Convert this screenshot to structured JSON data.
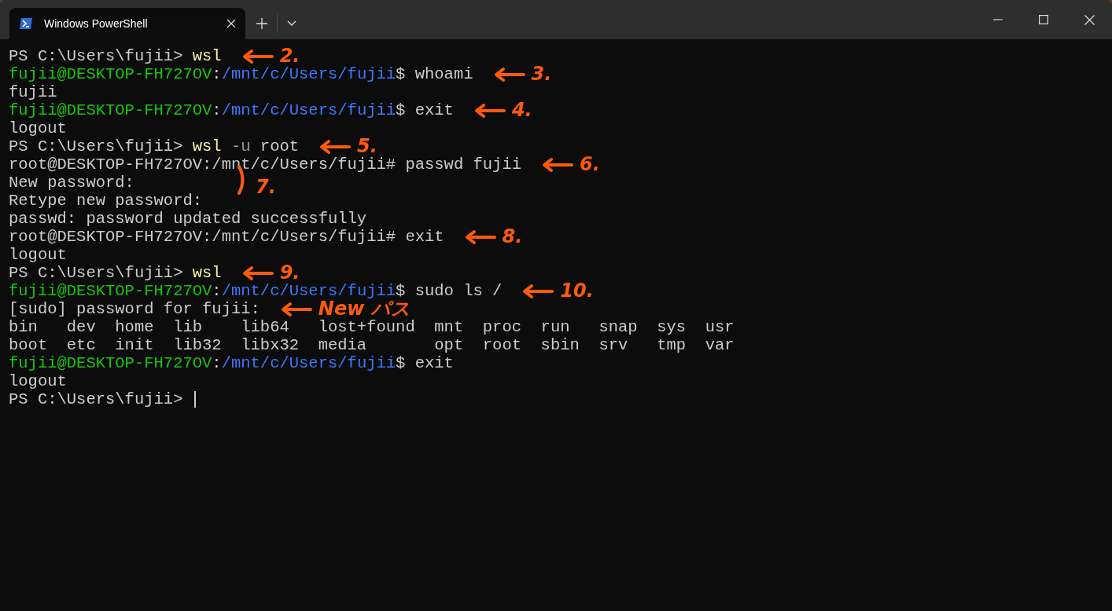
{
  "window": {
    "tabs": [
      {
        "title": "Windows PowerShell",
        "selected": true
      }
    ]
  },
  "terminal": {
    "lines": [
      {
        "segments": [
          {
            "kind": "plain",
            "text": "PS C:\\Users\\fujii> "
          },
          {
            "kind": "command",
            "text": "wsl"
          }
        ],
        "note": {
          "kind": "arrow",
          "text": "2."
        }
      },
      {
        "segments": [
          {
            "kind": "user",
            "text": "fujii@DESKTOP-FH727OV"
          },
          {
            "kind": "plain",
            "text": ":"
          },
          {
            "kind": "path",
            "text": "/mnt/c/Users/fujii"
          },
          {
            "kind": "plain",
            "text": "$ whoami"
          }
        ],
        "note": {
          "kind": "arrow",
          "text": "3."
        }
      },
      {
        "segments": [
          {
            "kind": "plain",
            "text": "fujii"
          }
        ]
      },
      {
        "segments": [
          {
            "kind": "user",
            "text": "fujii@DESKTOP-FH727OV"
          },
          {
            "kind": "plain",
            "text": ":"
          },
          {
            "kind": "path",
            "text": "/mnt/c/Users/fujii"
          },
          {
            "kind": "plain",
            "text": "$ exit"
          }
        ],
        "note": {
          "kind": "arrow",
          "text": "4."
        }
      },
      {
        "segments": [
          {
            "kind": "plain",
            "text": "logout"
          }
        ]
      },
      {
        "segments": [
          {
            "kind": "plain",
            "text": "PS C:\\Users\\fujii> "
          },
          {
            "kind": "command",
            "text": "wsl"
          },
          {
            "kind": "flag",
            "text": " -u"
          },
          {
            "kind": "plain",
            "text": " root"
          }
        ],
        "note": {
          "kind": "arrow",
          "text": "5."
        }
      },
      {
        "segments": [
          {
            "kind": "plain",
            "text": "root@DESKTOP-FH727OV:/mnt/c/Users/fujii# passwd fujii"
          }
        ],
        "note": {
          "kind": "arrow",
          "text": "6."
        }
      },
      {
        "segments": [
          {
            "kind": "plain",
            "text": "New password:"
          }
        ],
        "note": {
          "kind": "bracket",
          "text": "7."
        }
      },
      {
        "segments": [
          {
            "kind": "plain",
            "text": "Retype new password:"
          }
        ]
      },
      {
        "segments": [
          {
            "kind": "plain",
            "text": "passwd: password updated successfully"
          }
        ]
      },
      {
        "segments": [
          {
            "kind": "plain",
            "text": "root@DESKTOP-FH727OV:/mnt/c/Users/fujii# exit"
          }
        ],
        "note": {
          "kind": "arrow",
          "text": "8."
        }
      },
      {
        "segments": [
          {
            "kind": "plain",
            "text": "logout"
          }
        ]
      },
      {
        "segments": [
          {
            "kind": "plain",
            "text": "PS C:\\Users\\fujii> "
          },
          {
            "kind": "command",
            "text": "wsl"
          }
        ],
        "note": {
          "kind": "arrow",
          "text": "9."
        }
      },
      {
        "segments": [
          {
            "kind": "user",
            "text": "fujii@DESKTOP-FH727OV"
          },
          {
            "kind": "plain",
            "text": ":"
          },
          {
            "kind": "path",
            "text": "/mnt/c/Users/fujii"
          },
          {
            "kind": "plain",
            "text": "$ sudo ls /"
          }
        ],
        "note": {
          "kind": "arrow",
          "text": "10."
        }
      },
      {
        "segments": [
          {
            "kind": "plain",
            "text": "[sudo] password for fujii:"
          }
        ],
        "note": {
          "kind": "arrow",
          "text": "New パス"
        }
      },
      {
        "segments": [
          {
            "kind": "plain",
            "text": "bin   dev  home  lib    lib64   lost+found  mnt  proc  run   snap  sys  usr"
          }
        ]
      },
      {
        "segments": [
          {
            "kind": "plain",
            "text": "boot  etc  init  lib32  libx32  media       opt  root  sbin  srv   tmp  var"
          }
        ]
      },
      {
        "segments": [
          {
            "kind": "user",
            "text": "fujii@DESKTOP-FH727OV"
          },
          {
            "kind": "plain",
            "text": ":"
          },
          {
            "kind": "path",
            "text": "/mnt/c/Users/fujii"
          },
          {
            "kind": "plain",
            "text": "$ exit"
          }
        ]
      },
      {
        "segments": [
          {
            "kind": "plain",
            "text": "logout"
          }
        ]
      },
      {
        "segments": [
          {
            "kind": "plain",
            "text": "PS C:\\Users\\fujii> "
          }
        ],
        "cursor": true
      }
    ]
  }
}
